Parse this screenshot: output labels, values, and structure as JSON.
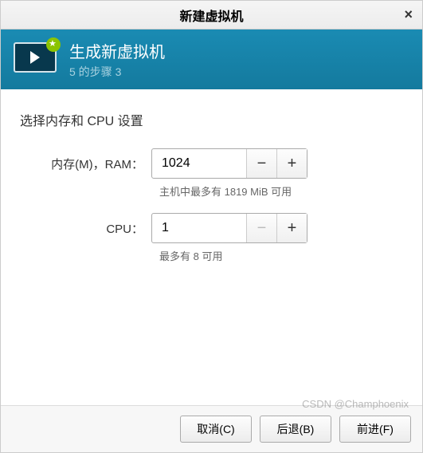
{
  "window": {
    "title": "新建虚拟机",
    "close": "×"
  },
  "header": {
    "title": "生成新虚拟机",
    "subtitle": "5 的步骤 3"
  },
  "section_title": "选择内存和 CPU 设置",
  "memory": {
    "label": "内存(M)，RAM：",
    "value": "1024",
    "minus": "−",
    "plus": "+",
    "hint": "主机中最多有 1819 MiB 可用"
  },
  "cpu": {
    "label": "CPU：",
    "value": "1",
    "minus": "−",
    "plus": "+",
    "hint": "最多有 8 可用"
  },
  "buttons": {
    "cancel": "取消(C)",
    "back": "后退(B)",
    "forward": "前进(F)"
  },
  "watermark": "CSDN @Champhoenix"
}
